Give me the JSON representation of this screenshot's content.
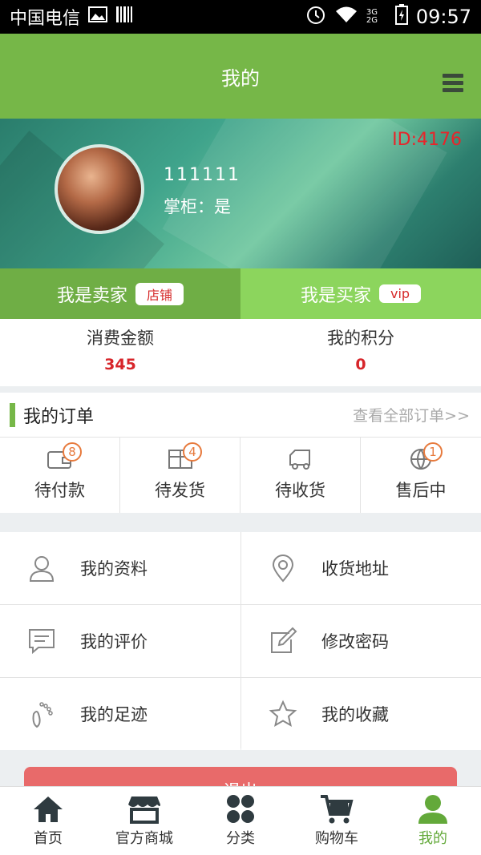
{
  "status_bar": {
    "carrier": "中国电信",
    "network": "3G 2G",
    "time": "09:57"
  },
  "header": {
    "title": "我的"
  },
  "profile": {
    "user_id": "ID:4176",
    "username": "111111",
    "shopkeeper_text": "掌柜：是"
  },
  "roles": {
    "seller": {
      "label": "我是卖家",
      "tag": "店铺"
    },
    "buyer": {
      "label": "我是买家",
      "tag": "vip"
    }
  },
  "stats": [
    {
      "label": "消费金额",
      "value": "345"
    },
    {
      "label": "我的积分",
      "value": "0"
    }
  ],
  "orders": {
    "title": "我的订单",
    "view_all": "查看全部订单>>",
    "items": [
      {
        "label": "待付款",
        "badge": "8",
        "icon": "wallet-icon"
      },
      {
        "label": "待发货",
        "badge": "4",
        "icon": "package-icon"
      },
      {
        "label": "待收货",
        "badge": "",
        "icon": "truck-icon"
      },
      {
        "label": "售后中",
        "badge": "1",
        "icon": "globe-icon"
      }
    ]
  },
  "menu": [
    {
      "label": "我的资料",
      "icon": "user-icon"
    },
    {
      "label": "收货地址",
      "icon": "location-pin-icon"
    },
    {
      "label": "我的评价",
      "icon": "comment-icon"
    },
    {
      "label": "修改密码",
      "icon": "edit-icon"
    },
    {
      "label": "我的足迹",
      "icon": "footprint-icon"
    },
    {
      "label": "我的收藏",
      "icon": "star-icon"
    }
  ],
  "logout_label": "退出",
  "bottom_nav": [
    {
      "label": "首页",
      "icon": "home-icon"
    },
    {
      "label": "官方商城",
      "icon": "store-icon"
    },
    {
      "label": "分类",
      "icon": "category-icon"
    },
    {
      "label": "购物车",
      "icon": "cart-icon"
    },
    {
      "label": "我的",
      "icon": "person-icon",
      "active": true
    }
  ],
  "colors": {
    "primary_green": "#76b748",
    "accent_red": "#d7252a",
    "badge_orange": "#e77a3d"
  }
}
